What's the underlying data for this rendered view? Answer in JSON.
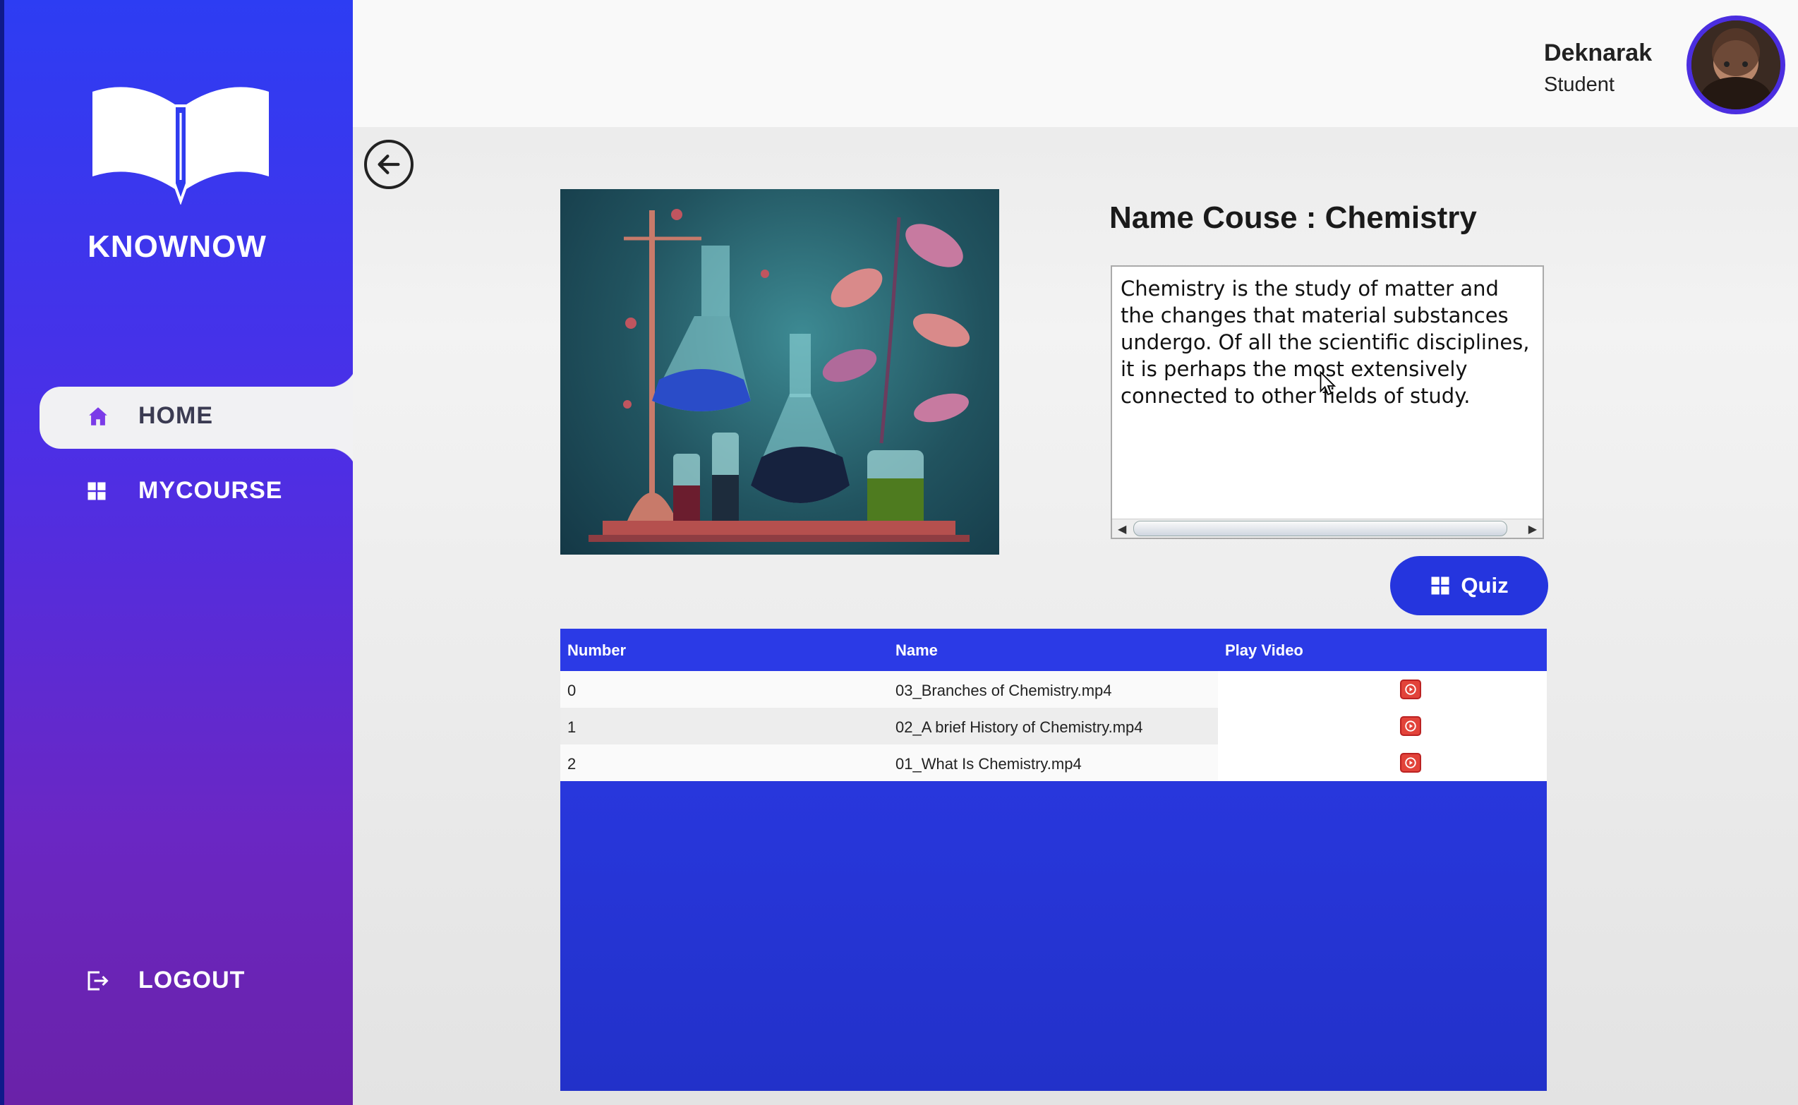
{
  "app": {
    "name": "KNOWNOW"
  },
  "sidebar": {
    "items": [
      {
        "label": "HOME",
        "icon": "home-icon",
        "active": true
      },
      {
        "label": "MYCOURSE",
        "icon": "grid-icon",
        "active": false
      }
    ],
    "logout": {
      "label": "LOGOUT",
      "icon": "logout-icon"
    }
  },
  "user": {
    "name": "Deknarak",
    "role": "Student"
  },
  "course": {
    "title": "Name Couse : Chemistry",
    "description": "Chemistry is the study of matter and\nthe changes that material substances\nundergo. Of all the scientific disciplines,\nit is perhaps the most extensively\nconnected to other fields of study."
  },
  "quiz": {
    "label": "Quiz"
  },
  "videos": {
    "headers": [
      "Number",
      "Name",
      "Play Video"
    ],
    "rows": [
      {
        "number": "0",
        "name": "03_Branches of Chemistry.mp4"
      },
      {
        "number": "1",
        "name": "02_A brief History of Chemistry.mp4"
      },
      {
        "number": "2",
        "name": "01_What Is Chemistry.mp4"
      }
    ]
  },
  "colors": {
    "accent": "#2535de",
    "sidebar_top": "#2d3df3",
    "sidebar_bottom": "#6a22a8",
    "play": "#e2433a"
  }
}
